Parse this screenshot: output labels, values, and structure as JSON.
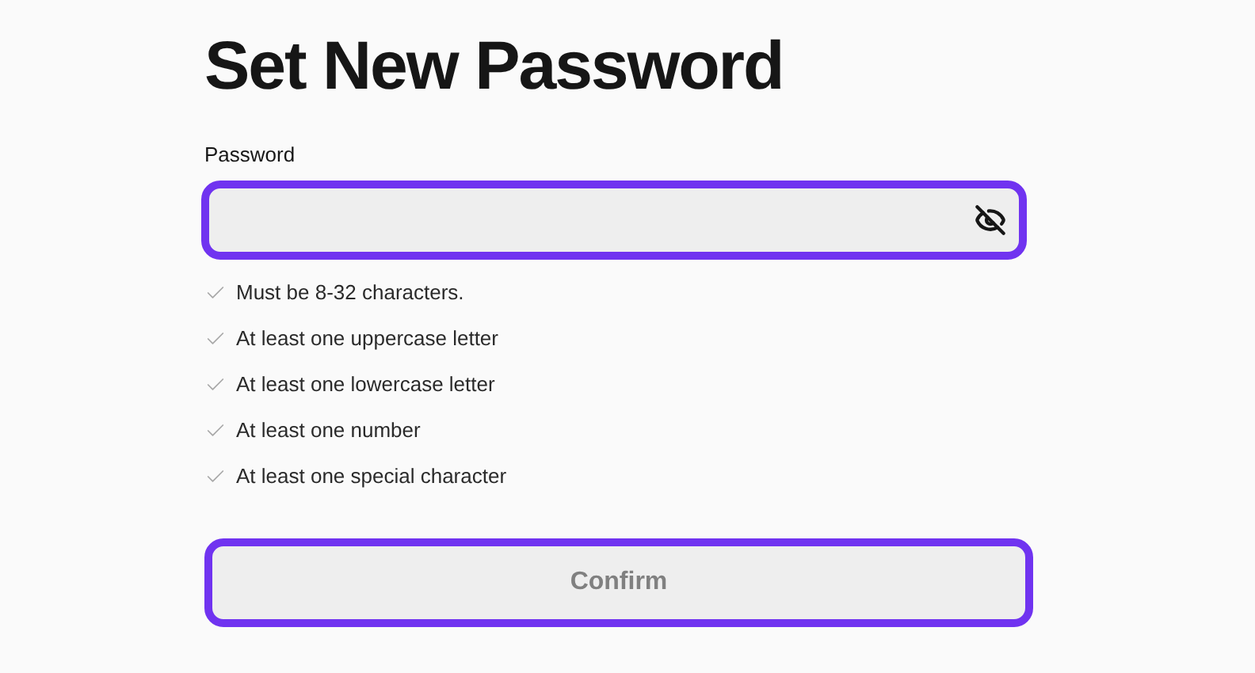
{
  "title": "Set New Password",
  "password_field": {
    "label": "Password",
    "visible": false
  },
  "rules": [
    {
      "text": "Must be 8-32 characters.",
      "met": false
    },
    {
      "text": "At least one uppercase letter",
      "met": false
    },
    {
      "text": "At least one lowercase letter",
      "met": false
    },
    {
      "text": "At least one number",
      "met": false
    },
    {
      "text": "At least one special character",
      "met": false
    }
  ],
  "confirm_button": {
    "label": "Confirm",
    "disabled": true
  }
}
